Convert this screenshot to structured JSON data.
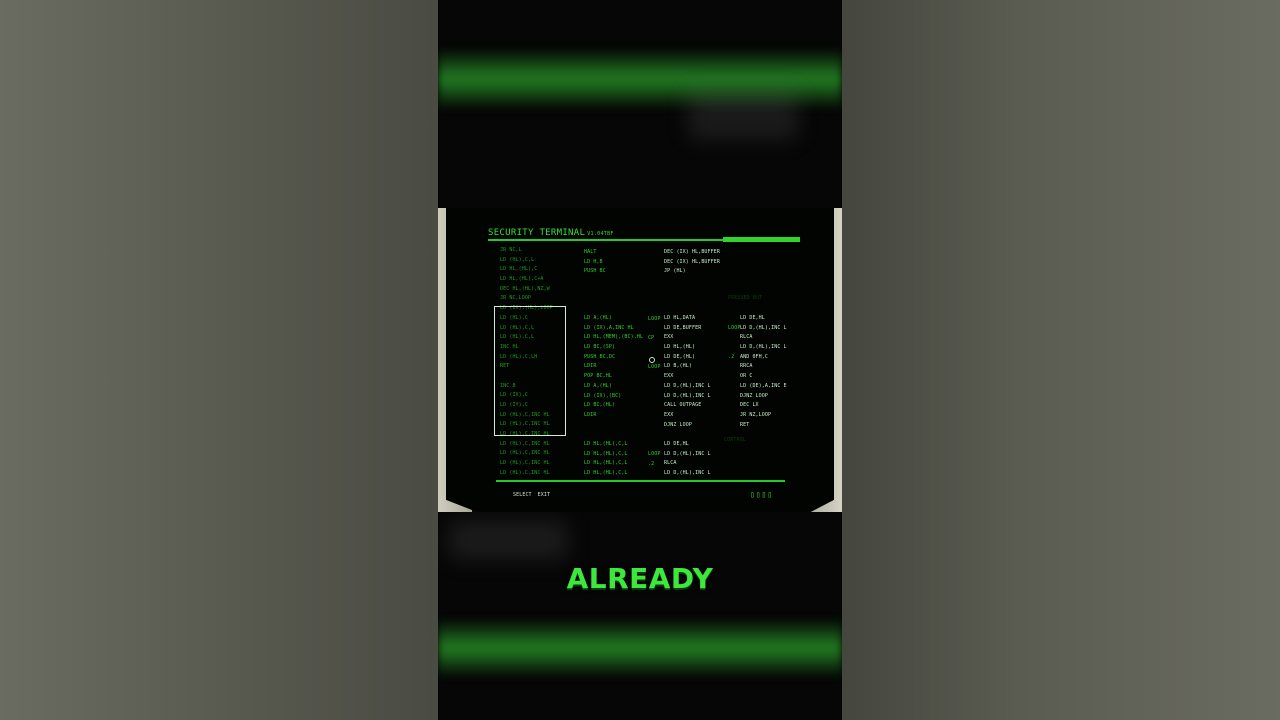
{
  "terminal": {
    "title": "SECURITY TERMINAL",
    "subtitle": "V1.04TBF",
    "col1": [
      "JR NC,L",
      "LD (HL),C,L",
      "LD HL,(HL),C",
      "LD HL,(HL),C+A",
      "DEC HL,(HL),NZ,W",
      "JR NC,LOOP",
      "LD (IX),(HL),LOOP",
      "LD (HL),C",
      "LD (HL),C,L",
      "LD (HL),C,L",
      "INC HL",
      "LD (HL),C,LH",
      "RET",
      "",
      "INC B",
      "LD (IX),C",
      "LD (IY),C",
      "LD (HL),C,INC HL",
      "LD (HL),C,INC HL",
      "LD (HL),C,INC HL",
      "LD (HL),C,INC HL",
      "LD (HL),C,INC HL",
      "LD (HL),C,INC HL",
      "LD (HL),C,INC HL"
    ],
    "col2a": [
      "HALT",
      "LD H,B",
      "PUSH BC"
    ],
    "col2b": [
      "LD A,(HL)",
      "LD (IX),A,INC HL",
      "LD HL,(MEM),(BC),HL",
      "LD BC,(SP)",
      "PUSH BC,DC",
      "LDIR",
      "POP BC,HL",
      "LD A,(HL)",
      "LD (IX),(BC)",
      "LD BC,(HL)",
      "LDIR"
    ],
    "col2c": [
      "LD HL,(HL),C,L",
      "LD HL,(HL),C,L",
      "LD HL,(HL),C,L",
      "LD HL,(HL),C,L"
    ],
    "col3a": [
      "DEC (IX) HL,BUFFER",
      "DEC (IX) HL,BUFFER",
      "JP (HL)"
    ],
    "col3b": [
      "LD HL,DATA",
      "LD DE,BUFFER",
      "EXX",
      "LD HL,(HL)",
      "LD DE,(HL)",
      "LD B,(HL)",
      "EXX",
      "LD D,(HL),INC L",
      "LD D,(HL),INC L",
      "CALL OUTPAGE",
      "EXX",
      "DJNZ LOOP"
    ],
    "col3c": [
      "LD DE,HL",
      "LD D,(HL),INC L",
      "RLCA",
      "LD D,(HL),INC L"
    ],
    "col4": [
      "LD DE,HL",
      "LD D,(HL),INC L",
      "RLCA",
      "LD D,(HL),INC L",
      "AND 0FH,C",
      "RRCA",
      "OR C",
      "LD (DE),A,INC E",
      "DJNZ LOOP",
      "DEC LX",
      "JR NZ,LOOP",
      "RET"
    ],
    "labels_a": [
      "LOOP",
      "",
      "CP",
      "",
      "",
      "LOOP"
    ],
    "labels_b": [
      "LOOP",
      "",
      "",
      ".2"
    ],
    "labels_c": [
      "LOOP",
      ".2"
    ],
    "footer_select": "SELECT",
    "footer_exit": "EXIT",
    "indicator": "▯▯▯▯",
    "faded_right": "PRESSED BUT",
    "faded_bottom": "CONTROL"
  },
  "caption": "ALREADY",
  "colors": {
    "terminal_green": "#2ed32e",
    "caption_green": "#3de83d"
  }
}
